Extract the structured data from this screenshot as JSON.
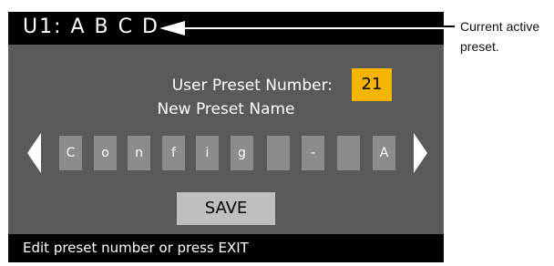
{
  "header": {
    "active_preset": "U1: A B C D"
  },
  "annotation": {
    "text_line1": "Current active",
    "text_line2": "preset."
  },
  "preset_number": {
    "label": "User Preset Number:",
    "value": "21"
  },
  "name_editor": {
    "label": "New Preset Name",
    "chars": [
      "C",
      "o",
      "n",
      "f",
      "i",
      "g",
      "",
      "-",
      "",
      "A"
    ]
  },
  "buttons": {
    "save": "SAVE"
  },
  "footer": {
    "hint": "Edit preset number or press EXIT"
  },
  "colors": {
    "screen_bg": "#5a5a5a",
    "accent_yellow": "#f4b400",
    "char_cell": "#8c8c8c",
    "save_btn": "#bfbfbf"
  }
}
